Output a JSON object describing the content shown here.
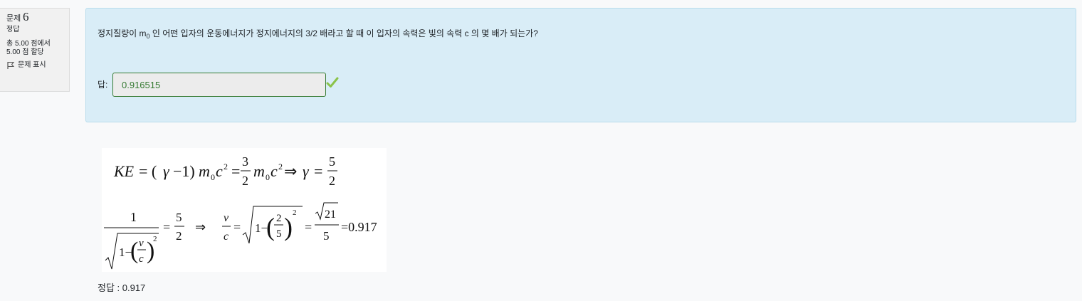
{
  "question_info": {
    "label": "문제",
    "number": "6",
    "state": "정답",
    "grade_line1": "총 5.00 점에서",
    "grade_line2": "5.00 점 할당",
    "flag_label": "문제 표시"
  },
  "question": {
    "text_before": "정지질량이 m",
    "text_sub": "0",
    "text_after": " 인 어떤 입자의 운동에너지가 정지에너지의 3/2 배라고 할 때 이 입자의 속력은 빛의 속력 c 의 몇 배가 되는가?"
  },
  "answer": {
    "label": "답:",
    "value": "0.916515"
  },
  "feedback": {
    "right_answer": "정답 : 0.917"
  },
  "colors": {
    "formulation_bg": "#d9edf7",
    "correct_green": "#357a32",
    "check_green": "#8bc34a"
  }
}
